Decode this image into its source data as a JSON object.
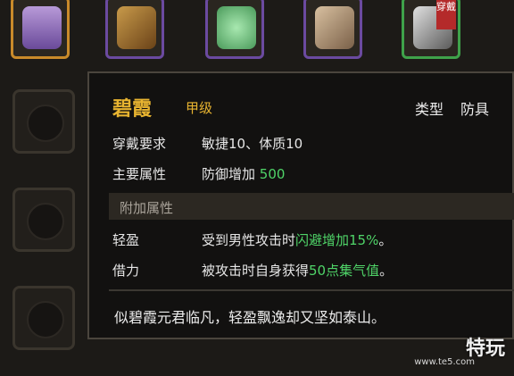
{
  "slots": [
    {
      "id": "slot-robe",
      "border": "orange",
      "item_color": "#8a6ab8"
    },
    {
      "id": "slot-leather",
      "border": "purple",
      "item_color": "#9a6a2a"
    },
    {
      "id": "slot-jade",
      "border": "purple",
      "item_color": "#7ac488"
    },
    {
      "id": "slot-stone",
      "border": "purple",
      "item_color": "#b59a7a"
    },
    {
      "id": "slot-blade",
      "border": "green",
      "item_color": "#9a9a9a",
      "tag": "穿戴"
    }
  ],
  "tooltip": {
    "name": "碧霞",
    "grade": "甲级",
    "type_label": "类型",
    "type_value": "防具",
    "requirement_label": "穿戴要求",
    "requirement_value": "敏捷10、体质10",
    "main_attr_label": "主要属性",
    "main_attr_prefix": "防御增加",
    "main_attr_value": "500",
    "extra_section": "附加属性",
    "traits": [
      {
        "label": "轻盈",
        "desc_prefix": "受到男性攻击时",
        "desc_highlight": "闪避增加15%",
        "desc_suffix": "。"
      },
      {
        "label": "借力",
        "desc_prefix": "被攻击时自身获得",
        "desc_highlight": "50点集气值",
        "desc_suffix": "。"
      }
    ],
    "flavor": "似碧霞元君临凡，轻盈飘逸却又坚如泰山。"
  },
  "watermark": {
    "brand": "特玩",
    "url": "www.te5.com"
  },
  "colors": {
    "gold": "#e8b430",
    "green_highlight": "#4fd468",
    "panel": "#121110"
  }
}
